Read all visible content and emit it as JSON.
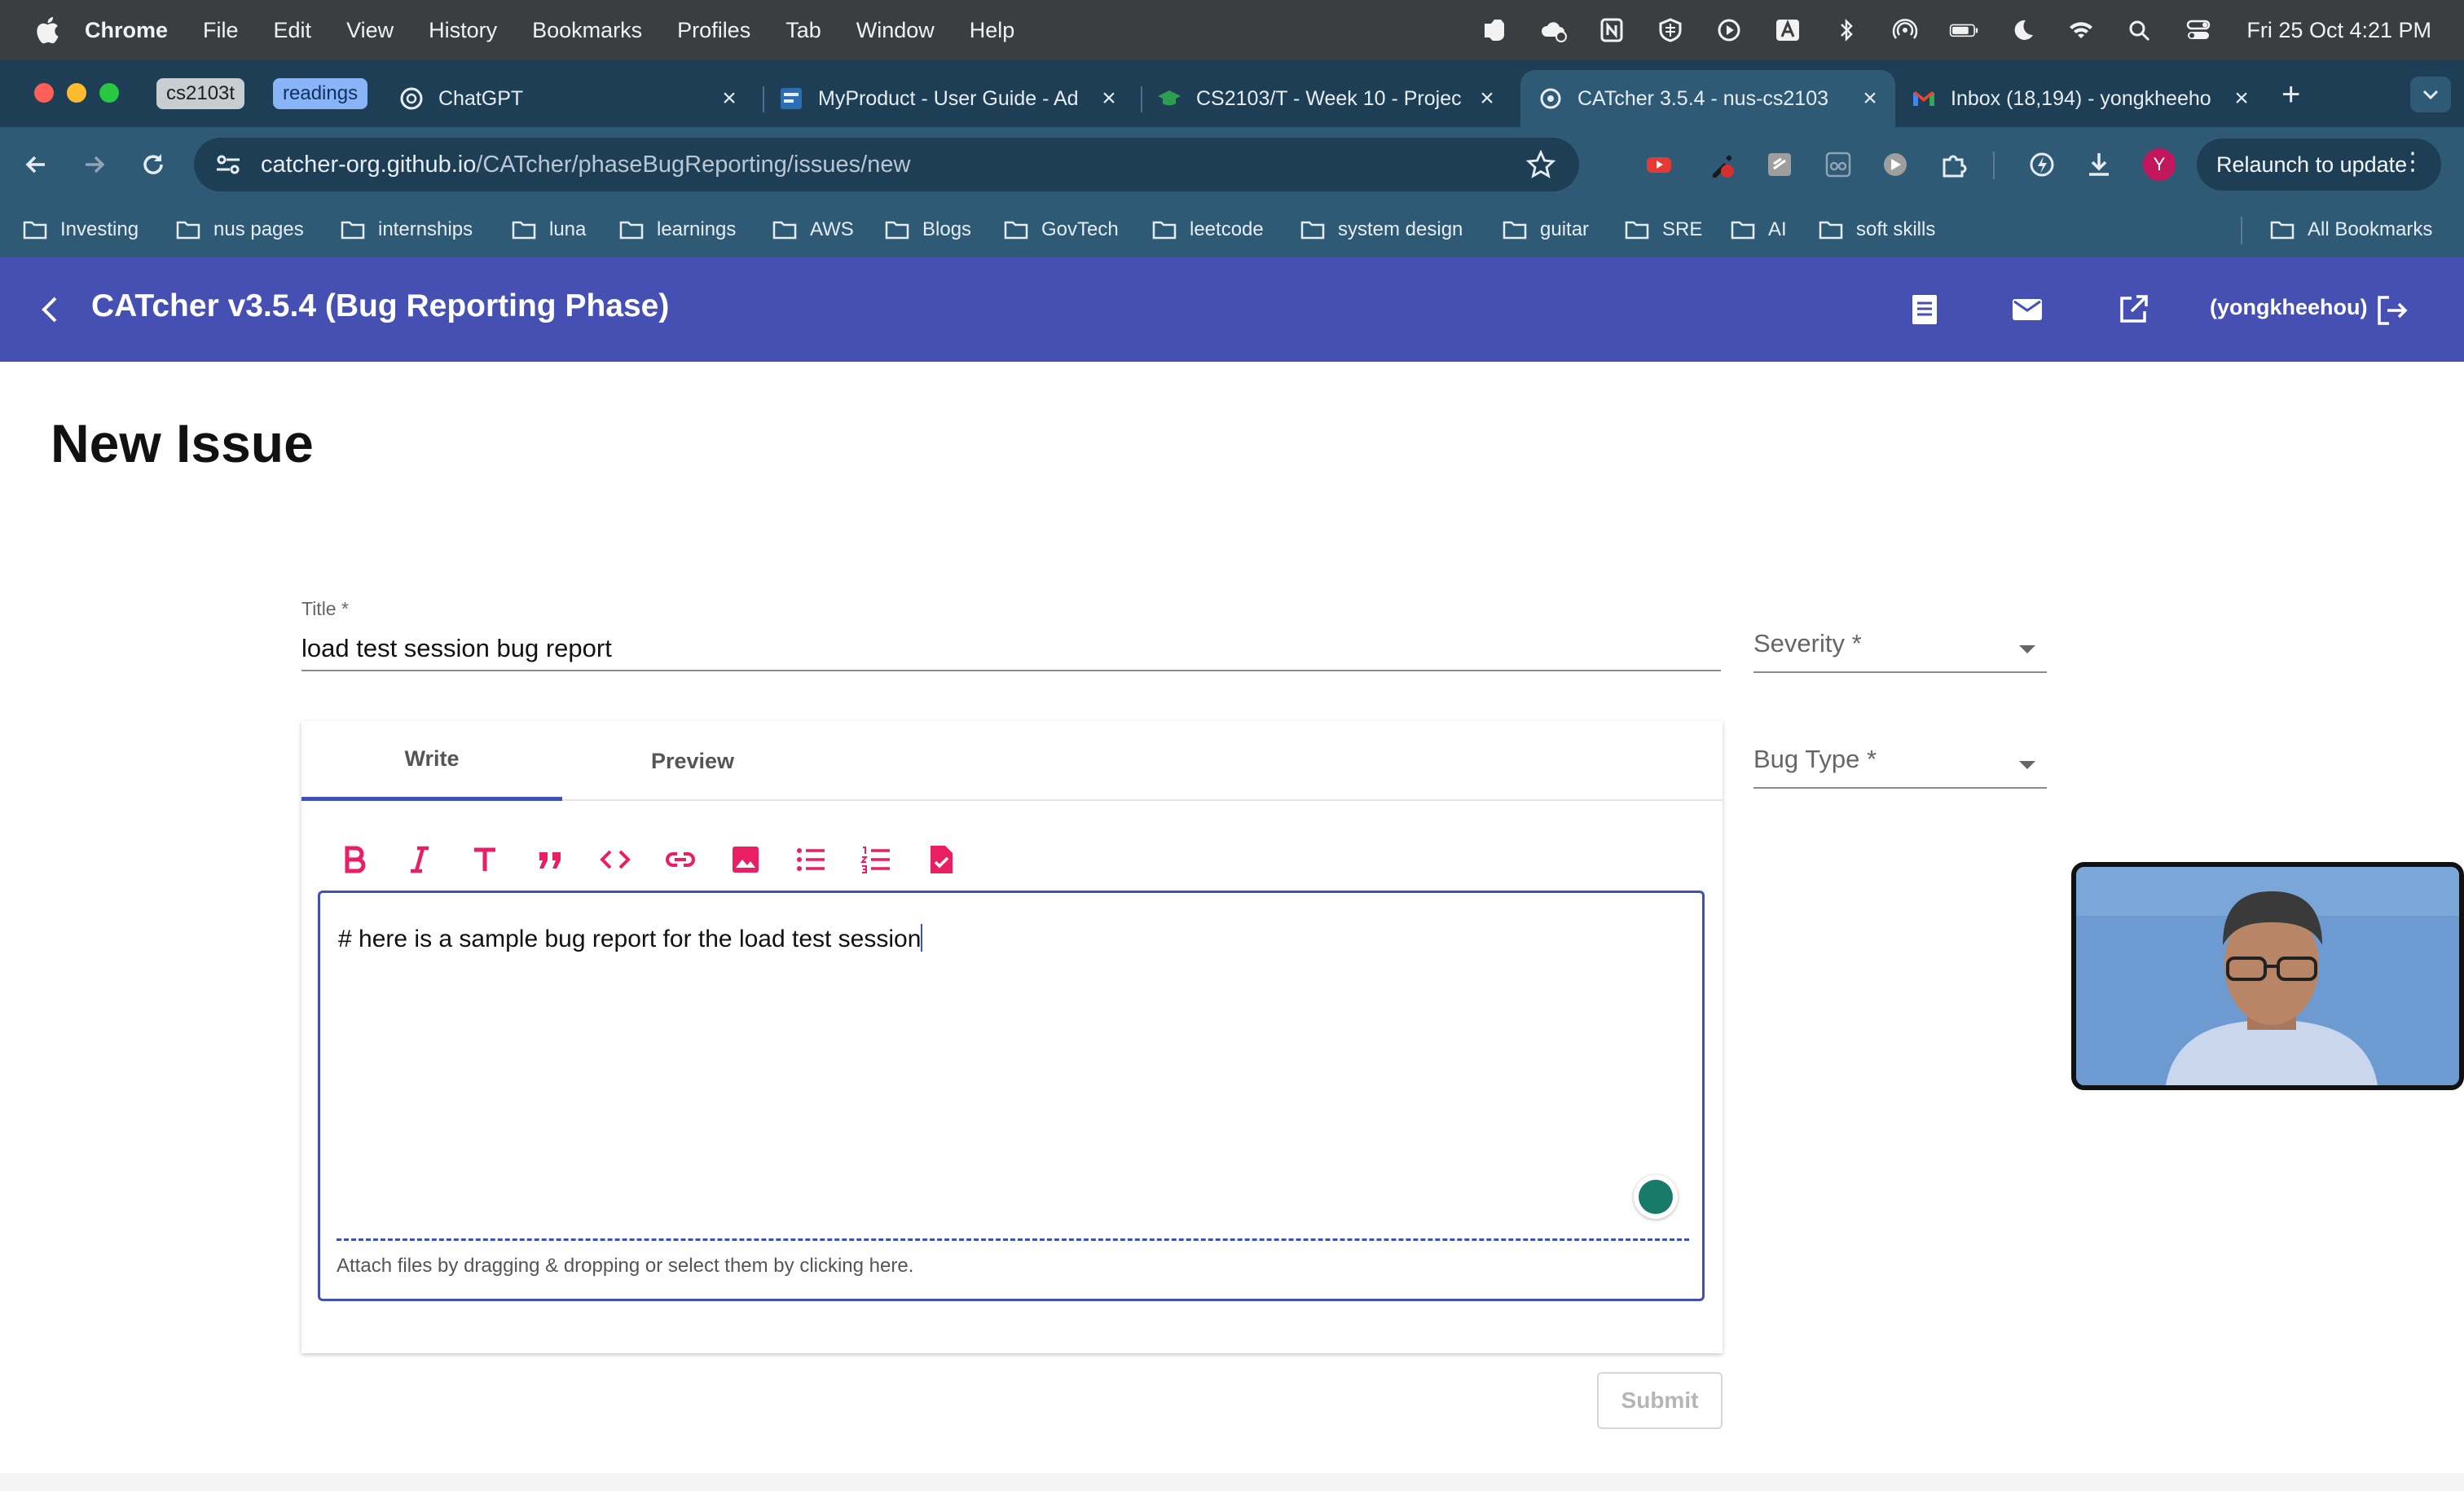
{
  "menubar": {
    "app_name": "Chrome",
    "menus": [
      "File",
      "Edit",
      "View",
      "History",
      "Bookmarks",
      "Profiles",
      "Tab",
      "Window",
      "Help"
    ],
    "status_icons": [
      "evernote-icon",
      "cloud-icon",
      "notion-icon",
      "grid-icon",
      "play-icon",
      "keyboard-a-icon",
      "bluetooth-icon",
      "airdrop-icon",
      "battery-icon",
      "moon-icon",
      "wifi-icon",
      "search-icon",
      "control-center-icon"
    ],
    "datetime": "Fri 25 Oct  4:21 PM"
  },
  "tabs": {
    "groups": [
      "cs2103t",
      "readings"
    ],
    "items": [
      {
        "title": "ChatGPT",
        "icon": "chatgpt-icon",
        "active": false
      },
      {
        "title": "MyProduct - User Guide - Ad",
        "icon": "se-edu-icon",
        "active": false
      },
      {
        "title": "CS2103/T - Week 10 - Projec",
        "icon": "graduation-cap-icon",
        "active": false
      },
      {
        "title": "CATcher 3.5.4 - nus-cs2103",
        "icon": "catcher-icon",
        "active": true
      },
      {
        "title": "Inbox (18,194) - yongkheeho",
        "icon": "gmail-icon",
        "active": false
      }
    ],
    "new_tab_symbol": "+"
  },
  "toolbar": {
    "url_host": "catcher-org.github.io",
    "url_path": "/CATcher/phaseBugReporting/issues/new",
    "profile_initial": "Y",
    "relaunch_label": "Relaunch to update"
  },
  "bookmarks": {
    "items": [
      "Investing",
      "nus pages",
      "internships",
      "luna",
      "learnings",
      "AWS",
      "Blogs",
      "GovTech",
      "leetcode",
      "system design",
      "guitar",
      "SRE",
      "AI",
      "soft skills"
    ],
    "all_label": "All Bookmarks"
  },
  "app": {
    "title": "CATcher v3.5.4  (Bug Reporting Phase)",
    "username": "(yongkheehou)"
  },
  "page": {
    "heading": "New Issue",
    "title_label": "Title *",
    "title_value": "load test session bug report",
    "severity_label": "Severity *",
    "bug_type_label": "Bug Type *",
    "editor_tabs": [
      "Write",
      "Preview"
    ],
    "editor_content": "# here is a sample bug report for the load test session",
    "attach_hint": "Attach files by dragging & dropping or select them by clicking here.",
    "submit_label": "Submit"
  },
  "colors": {
    "app_bar": "#4650b3",
    "accent": "#3f51b5",
    "markdown_icons": "#e91e63",
    "tabstrip": "#1d3e54",
    "toolbar": "#2e5a75"
  }
}
